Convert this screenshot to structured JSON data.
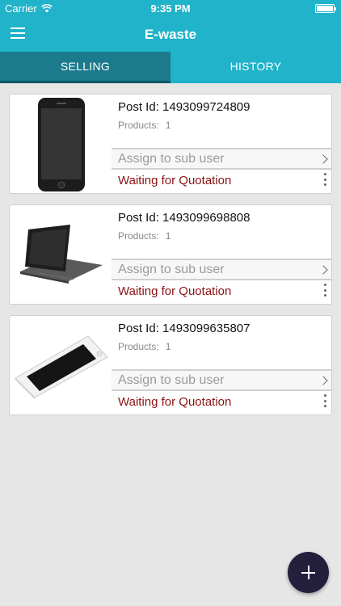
{
  "status_bar": {
    "carrier": "Carrier",
    "time": "9:35 PM"
  },
  "nav": {
    "title": "E-waste",
    "menu_icon": "hamburger-menu-icon"
  },
  "tabs": [
    {
      "label": "SELLING",
      "active": true
    },
    {
      "label": "HISTORY",
      "active": false
    }
  ],
  "posts": [
    {
      "post_id_label": "Post Id:",
      "post_id": "1493099724809",
      "products_label": "Products:",
      "products_count": "1",
      "assign_label": "Assign to sub user",
      "status": "Waiting for Quotation",
      "image": "smartphone-black"
    },
    {
      "post_id_label": "Post Id:",
      "post_id": "1493099698808",
      "products_label": "Products:",
      "products_count": "1",
      "assign_label": "Assign to sub user",
      "status": "Waiting for Quotation",
      "image": "tablet-case"
    },
    {
      "post_id_label": "Post Id:",
      "post_id": "1493099635807",
      "products_label": "Products:",
      "products_count": "1",
      "assign_label": "Assign to sub user",
      "status": "Waiting for Quotation",
      "image": "smartphone-white"
    }
  ],
  "fab": {
    "icon": "plus-icon"
  },
  "colors": {
    "primary": "#20b3c9",
    "tab_active": "#1b7a8c",
    "status": "#8b1212",
    "fab": "#241f3d"
  }
}
